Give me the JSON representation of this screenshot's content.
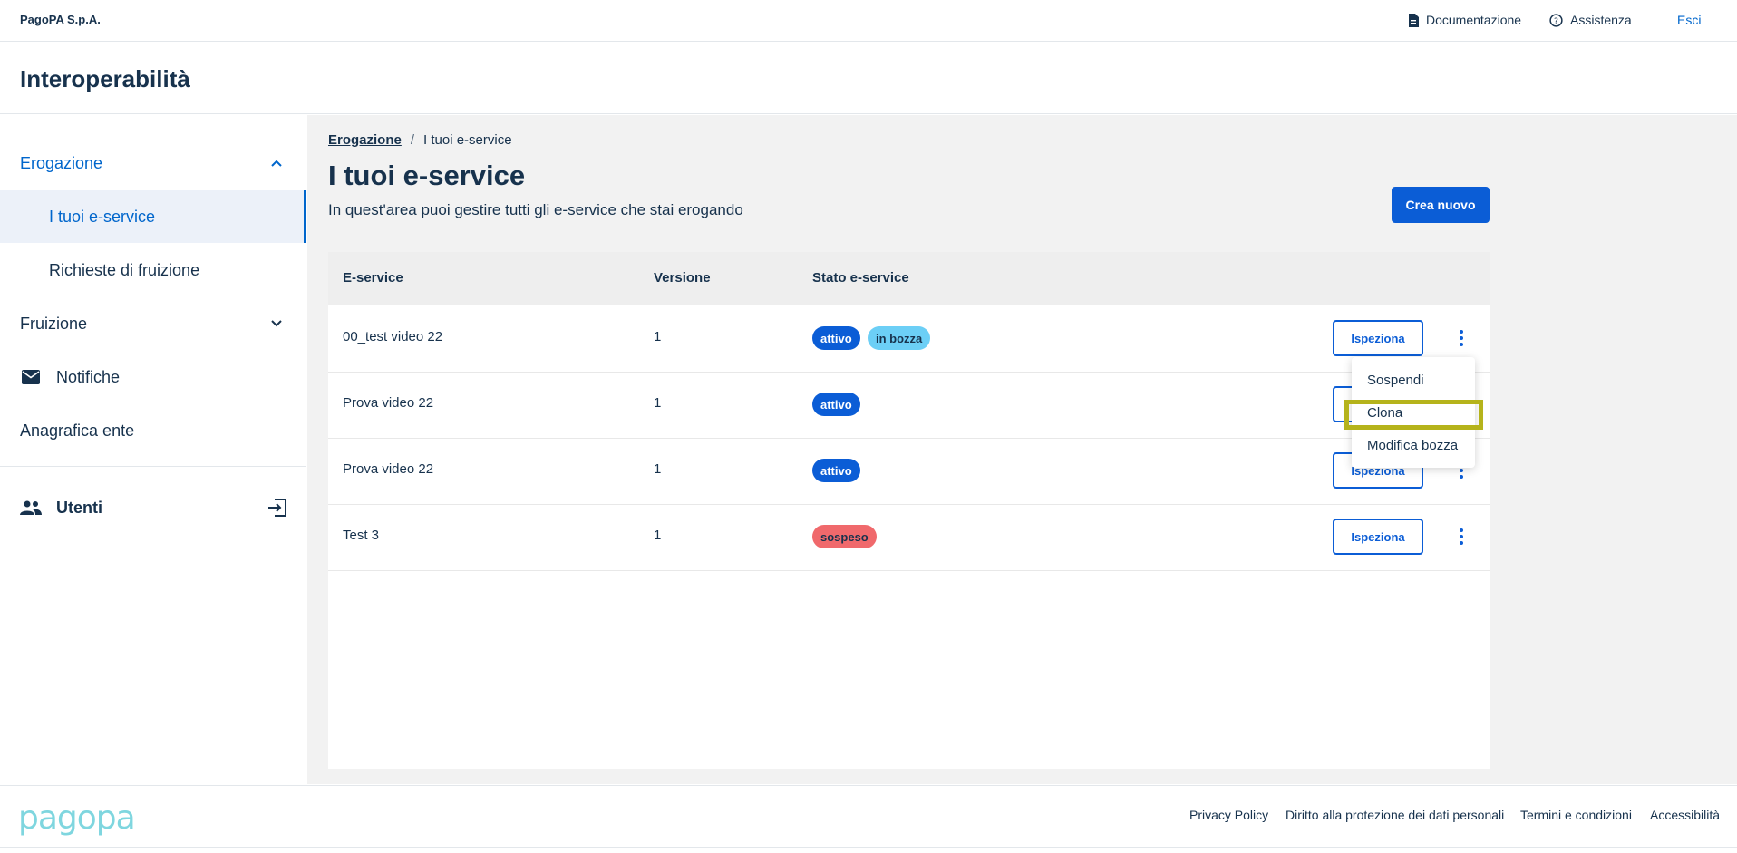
{
  "topbar": {
    "org_name": "PagoPA S.p.A.",
    "documentation": "Documentazione",
    "assistance": "Assistenza",
    "logout": "Esci"
  },
  "header": {
    "product_title": "Interoperabilità"
  },
  "sidebar": {
    "erogazione": "Erogazione",
    "i_tuoi_eservice": "I tuoi e-service",
    "richieste": "Richieste di fruizione",
    "fruizione": "Fruizione",
    "notifiche": "Notifiche",
    "anagrafica": "Anagrafica ente",
    "utenti": "Utenti"
  },
  "breadcrumb": {
    "parent": "Erogazione",
    "separator": "/",
    "current": "I tuoi e-service"
  },
  "page": {
    "title": "I tuoi e-service",
    "subtitle": "In quest'area puoi gestire tutti gli e-service che stai erogando",
    "create_button": "Crea nuovo"
  },
  "table": {
    "headers": [
      "E-service",
      "Versione",
      "Stato e-service"
    ],
    "inspect_label": "Ispeziona",
    "rows": [
      {
        "name": "00_test video 22",
        "version": "1",
        "badges": [
          "attivo",
          "in bozza"
        ]
      },
      {
        "name": "Prova video 22",
        "version": "1",
        "badges": [
          "attivo"
        ]
      },
      {
        "name": "Prova video 22",
        "version": "1",
        "badges": [
          "attivo"
        ]
      },
      {
        "name": "Test 3",
        "version": "1",
        "badges": [
          "sospeso"
        ]
      }
    ]
  },
  "context_menu": {
    "items": [
      "Sospendi",
      "Clona",
      "Modifica bozza"
    ],
    "highlighted": "Clona"
  },
  "footer": {
    "logo_text": "pagopa",
    "links": [
      "Privacy Policy",
      "Diritto alla protezione dei dati personali",
      "Termini e condizioni",
      "Accessibilità"
    ]
  },
  "colors": {
    "primary": "#0b5dd6",
    "badge_active": "#0b5dd6",
    "badge_draft": "#6ccff6",
    "badge_suspended": "#f0696c",
    "highlight": "#b5b31b"
  }
}
